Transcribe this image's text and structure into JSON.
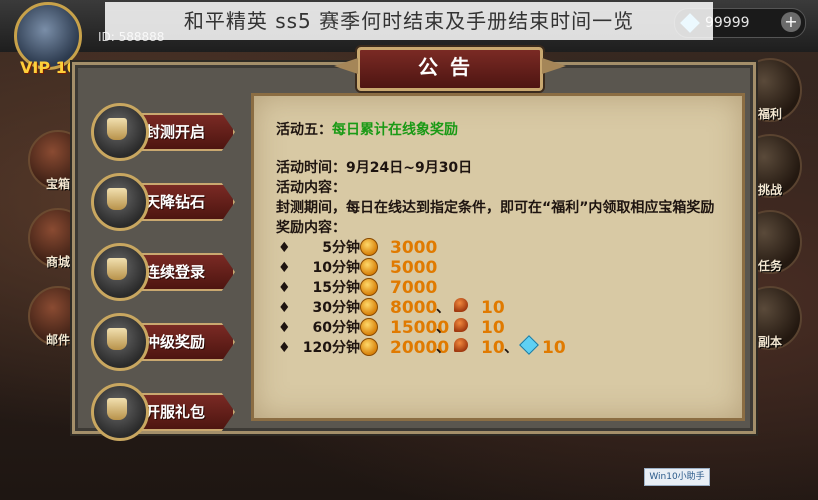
{
  "article_title": "和平精英 ss5 赛季何时结束及手册结束时间一览",
  "hud": {
    "vip_label": "VIP 10",
    "player_id": "ID: 588888",
    "currency_value": "99999",
    "currency_plus": "+"
  },
  "left_nav": [
    {
      "label": "宝箱"
    },
    {
      "label": "商城"
    },
    {
      "label": "邮件"
    }
  ],
  "right_nav": [
    {
      "label": "福利"
    },
    {
      "label": "挑战"
    },
    {
      "label": "任务"
    },
    {
      "label": "副本"
    }
  ],
  "dialog": {
    "title": "公告",
    "tabs": [
      {
        "label": "封测开启"
      },
      {
        "label": "天降钻石"
      },
      {
        "label": "连续登录"
      },
      {
        "label": "冲级奖励"
      },
      {
        "label": "开服礼包"
      }
    ],
    "content": {
      "activity_label": "活动五：",
      "activity_name": "每日累计在线象奖励",
      "time_line": "活动时间：9月24日~9月30日",
      "content_label": "活动内容：",
      "description": "封测期间，每日在线达到指定条件，即可在“福利”内领取相应宝箱奖励",
      "reward_label": "奖励内容：",
      "rewards": [
        {
          "time": "5分钟：",
          "gold": "3000",
          "food": "",
          "gem": ""
        },
        {
          "time": "10分钟：",
          "gold": "5000",
          "food": "",
          "gem": ""
        },
        {
          "time": "15分钟：",
          "gold": "7000",
          "food": "",
          "gem": ""
        },
        {
          "time": "30分钟：",
          "gold": "8000",
          "food": "10",
          "gem": ""
        },
        {
          "time": "60分钟：",
          "gold": "15000",
          "food": "10",
          "gem": ""
        },
        {
          "time": "120分钟：",
          "gold": "20000",
          "food": "10",
          "gem": "10"
        }
      ],
      "bullet": "♦",
      "separator": "、"
    }
  },
  "watermark": "Win10小助手",
  "colors": {
    "tab_red": "#7a2a24",
    "gold_text": "#e07a00",
    "highlight_green": "#1a9a16",
    "parchment": "#d8c9a4"
  }
}
